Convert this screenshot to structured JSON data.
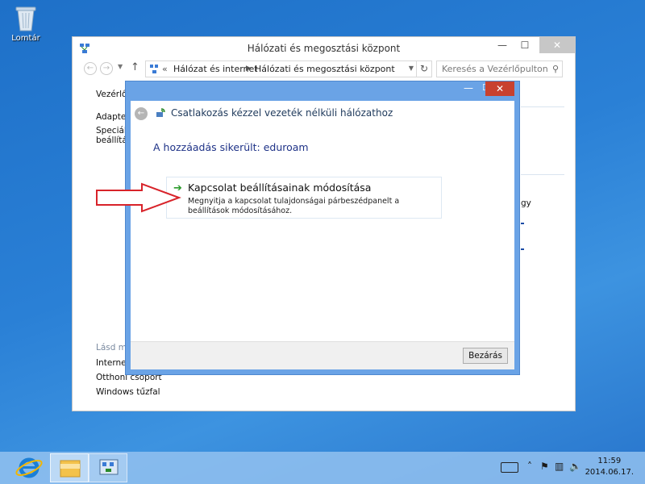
{
  "desktop": {
    "recycle_bin_label": "Lomtár"
  },
  "window": {
    "title": "Hálózati és megosztási központ",
    "minimize": "—",
    "maximize": "☐",
    "close": "✕"
  },
  "address": {
    "root_chevron": "«",
    "crumb_1": "Hálózat és internet",
    "crumb_sep": "▶",
    "crumb_2": "Hálózati és megosztási központ",
    "dropdown": "▼",
    "refresh": "↻"
  },
  "nav": {
    "back": "←",
    "forward": "→",
    "recent": "▼",
    "up": "↑"
  },
  "search": {
    "placeholder": "Keresés a Vezérlőpulton",
    "icon": "⚲"
  },
  "sidebar": {
    "items": [
      {
        "label": "Vezérlőp"
      },
      {
        "label": "Adapterb"
      },
      {
        "label": "Speciális"
      },
      {
        "label": "beállítás"
      }
    ],
    "see_also": "Lásd még",
    "links": [
      {
        "label": "Internetb"
      },
      {
        "label": "Otthoni csoport"
      },
      {
        "label": "Windows tűzfal"
      }
    ]
  },
  "main_bg": {
    "fragment": "gy"
  },
  "dialog": {
    "title_min": "—",
    "title_max": "☐",
    "title_close": "✕",
    "back": "←",
    "header": "Csatlakozás kézzel vezeték nélküli hálózathoz",
    "success": "A hozzáadás sikerült: eduroam",
    "option": {
      "arrow": "➔",
      "title": "Kapcsolat beállításainak módosítása",
      "description": "Megnyitja a kapcsolat tulajdonságai párbeszédpanelt a beállítások módosításához."
    },
    "close_button": "Bezárás"
  },
  "taskbar": {
    "clock_time": "11:59",
    "clock_date": "2014.06.17."
  },
  "colors": {
    "dialog_chrome": "#6aa3e6",
    "close_red": "#c8412f",
    "arrow_red": "#d8232a",
    "link_blue": "#1e3287"
  }
}
